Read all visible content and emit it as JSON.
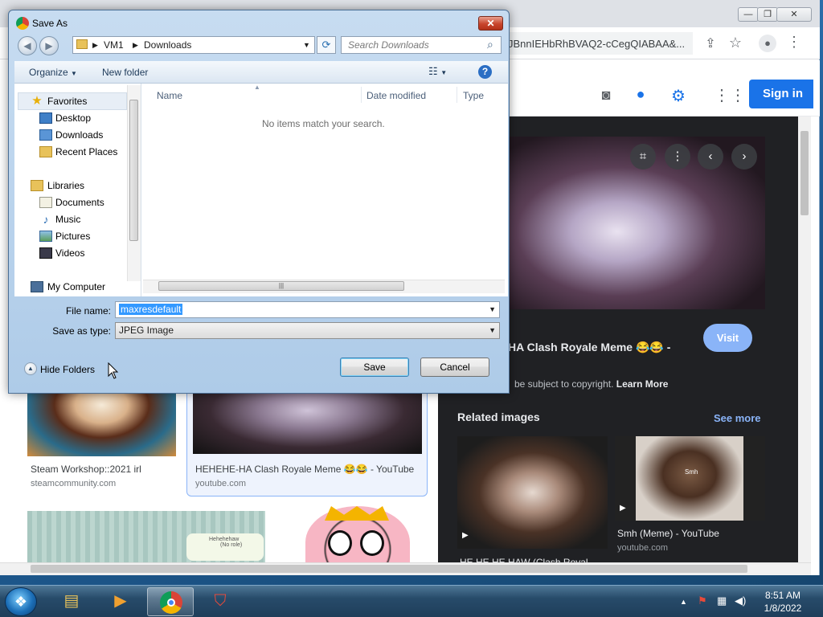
{
  "chrome": {
    "omnibox_text": "JBnnIEHbRhBVAQ2-cCegQIABAA&...",
    "sign_in": "Sign in"
  },
  "side_panel": {
    "title": "HA Clash Royale Meme 😂😂 -",
    "visit": "Visit",
    "copyright_prefix": "be subject to copyright.",
    "learn_more": "Learn More",
    "related": "Related images",
    "see_more": "See more",
    "related_items": [
      {
        "title": "HE HE HE HAW (Clash Royal...",
        "source": ""
      },
      {
        "title": "Smh (Meme) - YouTube",
        "source": "youtube.com",
        "overlay": "Smh"
      }
    ]
  },
  "results": [
    {
      "title": "Steam Workshop::2021 irl",
      "source": "steamcommunity.com"
    },
    {
      "title": "HEHEHE-HA Clash Royale Meme 😂😂 - YouTube",
      "source": "youtube.com"
    }
  ],
  "thumb_text": {
    "card_top": "Hehehehaw",
    "card_bottom": "(No role)"
  },
  "dialog": {
    "title": "Save As",
    "address": [
      "VM1",
      "Downloads"
    ],
    "search_placeholder": "Search Downloads",
    "organize": "Organize",
    "new_folder": "New folder",
    "help": "?",
    "nav": {
      "favorites": "Favorites",
      "favorites_items": [
        "Desktop",
        "Downloads",
        "Recent Places"
      ],
      "libraries": "Libraries",
      "library_items": [
        "Documents",
        "Music",
        "Pictures",
        "Videos"
      ],
      "computer": "My Computer"
    },
    "columns": [
      "Name",
      "Date modified",
      "Type"
    ],
    "empty_message": "No items match your search.",
    "file_name_label": "File name:",
    "file_name_value": "maxresdefault",
    "save_type_label": "Save as type:",
    "save_type_value": "JPEG Image",
    "hide_folders": "Hide Folders",
    "save": "Save",
    "cancel": "Cancel"
  },
  "taskbar": {
    "time": "8:51 AM",
    "date": "1/8/2022"
  },
  "icons": {
    "nav_back": "◀",
    "nav_forward": "▶",
    "refresh": "⟳",
    "search": "⌕",
    "close": "✕",
    "dropdown": "▼",
    "scroll_grip": "|||",
    "collapse": "▲"
  },
  "colors": {
    "accent": "#1a73e8",
    "dark_panel": "#202124",
    "selection": "#3399ff",
    "link_blue": "#8ab4f8"
  }
}
